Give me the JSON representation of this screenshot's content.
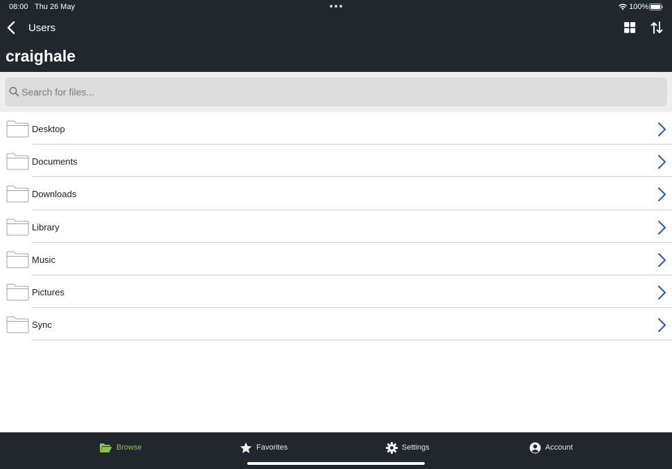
{
  "status_bar": {
    "time": "08:00",
    "date": "Thu 26 May",
    "battery_percent": "100%"
  },
  "nav": {
    "back_title": "Users",
    "page_title": "craighale"
  },
  "search": {
    "placeholder": "Search for files...",
    "value": ""
  },
  "folders": [
    {
      "name": "Desktop"
    },
    {
      "name": "Documents"
    },
    {
      "name": "Downloads"
    },
    {
      "name": "Library"
    },
    {
      "name": "Music"
    },
    {
      "name": "Pictures"
    },
    {
      "name": "Sync"
    }
  ],
  "tabs": [
    {
      "label": "Browse",
      "icon": "folder-open-icon",
      "active": true
    },
    {
      "label": "Favorites",
      "icon": "star-icon",
      "active": false
    },
    {
      "label": "Settings",
      "icon": "gear-icon",
      "active": false
    },
    {
      "label": "Account",
      "icon": "user-circle-icon",
      "active": false
    }
  ],
  "colors": {
    "header_bg": "#22262d",
    "accent_active_tab": "#8cc34b",
    "chevron": "#2f62a8",
    "folder_stroke": "#a0a0a0"
  }
}
